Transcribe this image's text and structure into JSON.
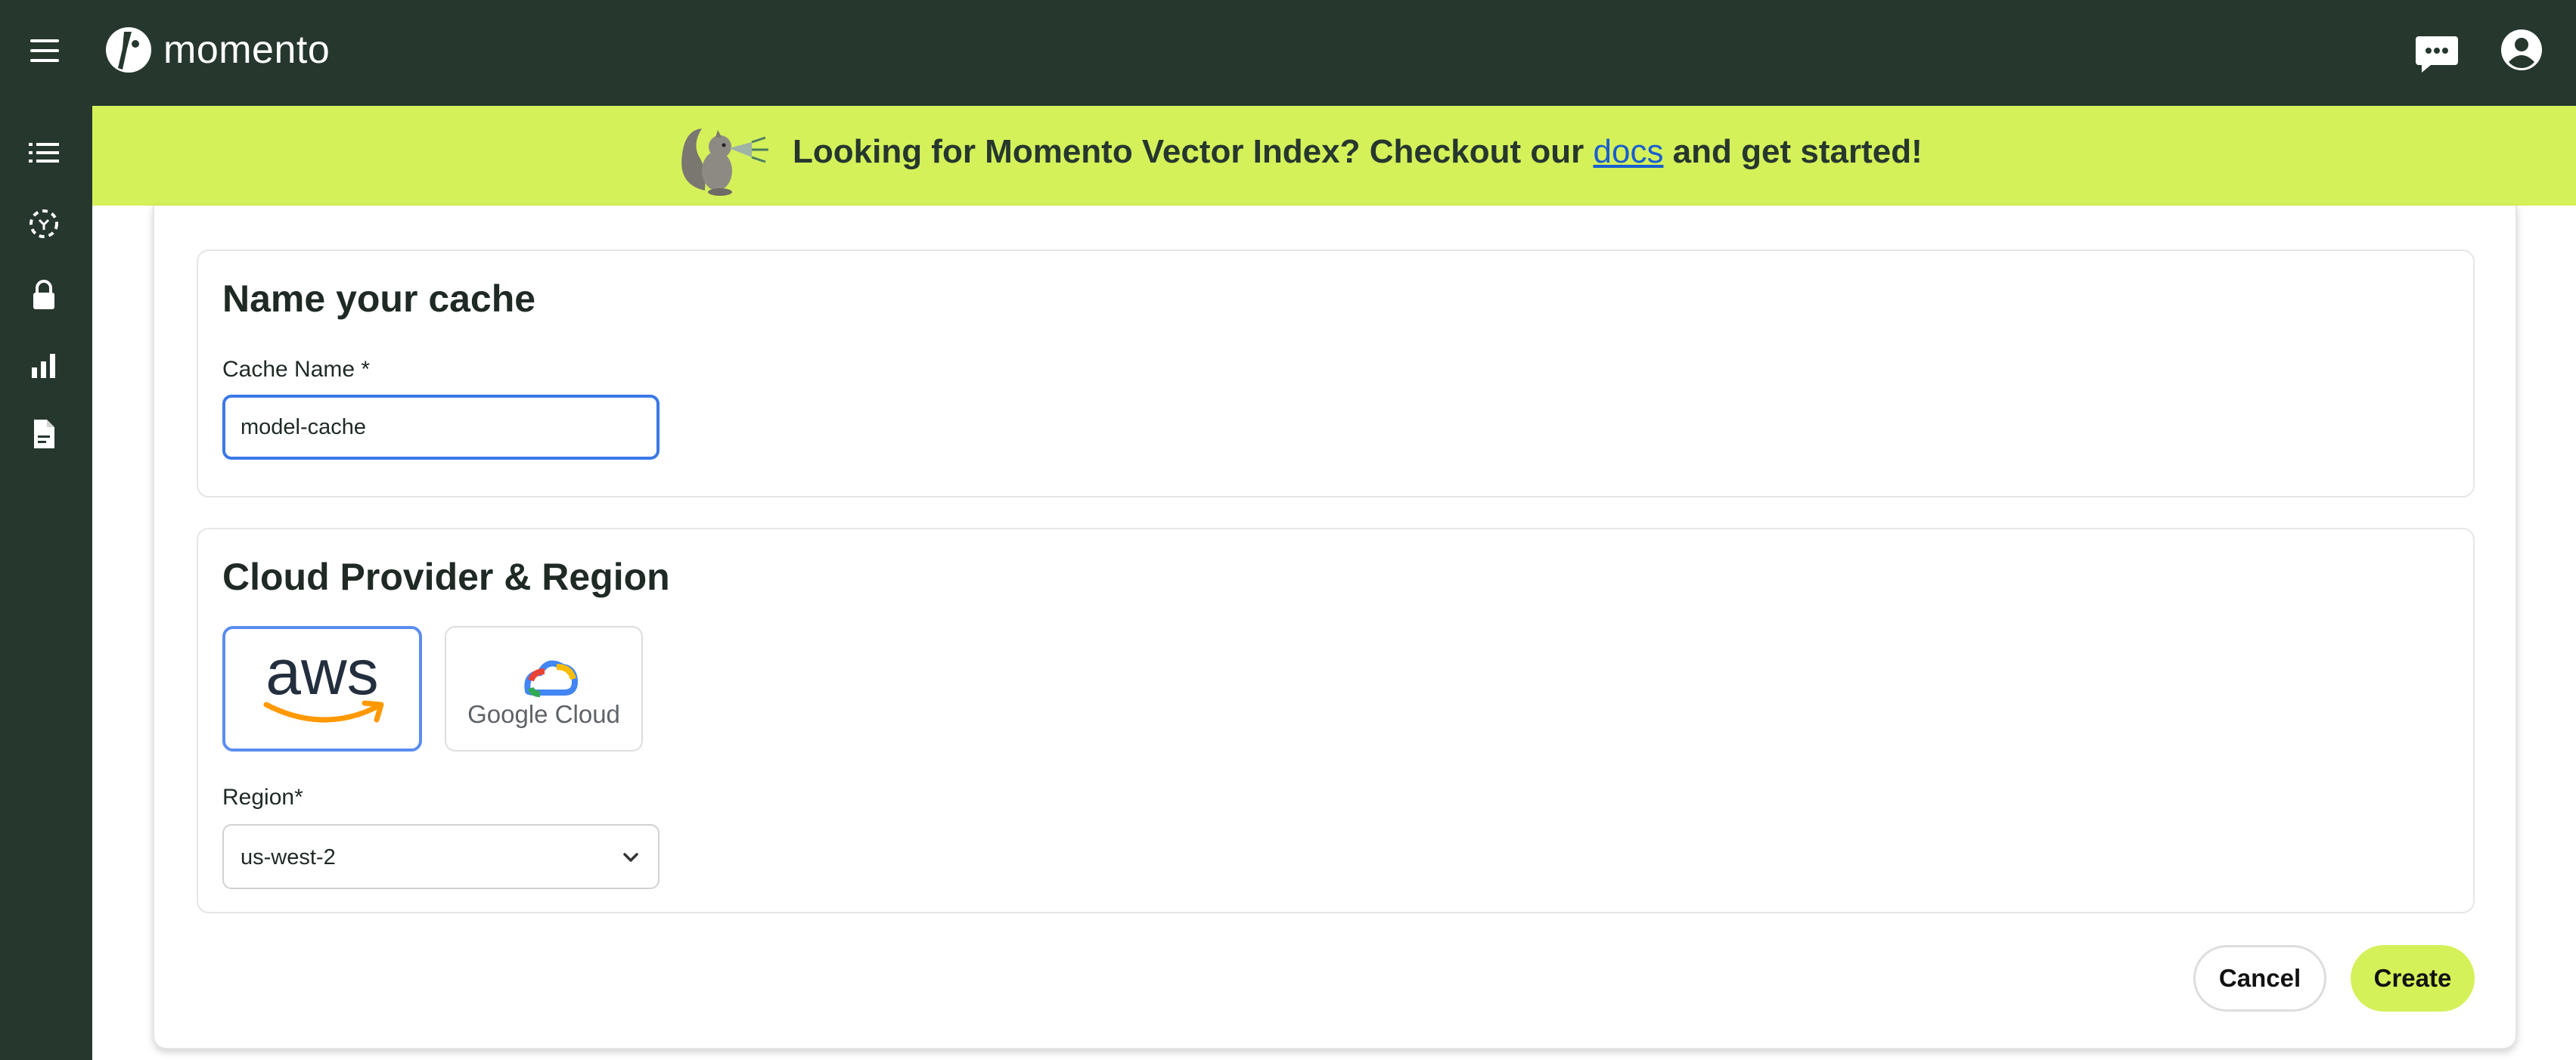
{
  "header": {
    "logo_text": "momento"
  },
  "banner": {
    "text_before": "Looking for Momento Vector Index? Checkout our ",
    "link_text": "docs",
    "text_after": " and get started!"
  },
  "name_section": {
    "title": "Name your cache",
    "cache_name_label": "Cache Name *",
    "cache_name_value": "model-cache"
  },
  "cloud_section": {
    "title": "Cloud Provider & Region",
    "providers": [
      {
        "name": "aws",
        "selected": true
      },
      {
        "name": "Google Cloud",
        "selected": false
      }
    ],
    "region_label": "Region*",
    "region_value": "us-west-2"
  },
  "actions": {
    "cancel_label": "Cancel",
    "create_label": "Create"
  },
  "colors": {
    "nav_bg": "#26372e",
    "accent": "#d4f15a",
    "focus_blue": "#3b78e7",
    "aws_orange": "#ff9900",
    "aws_navy": "#232f3e"
  }
}
